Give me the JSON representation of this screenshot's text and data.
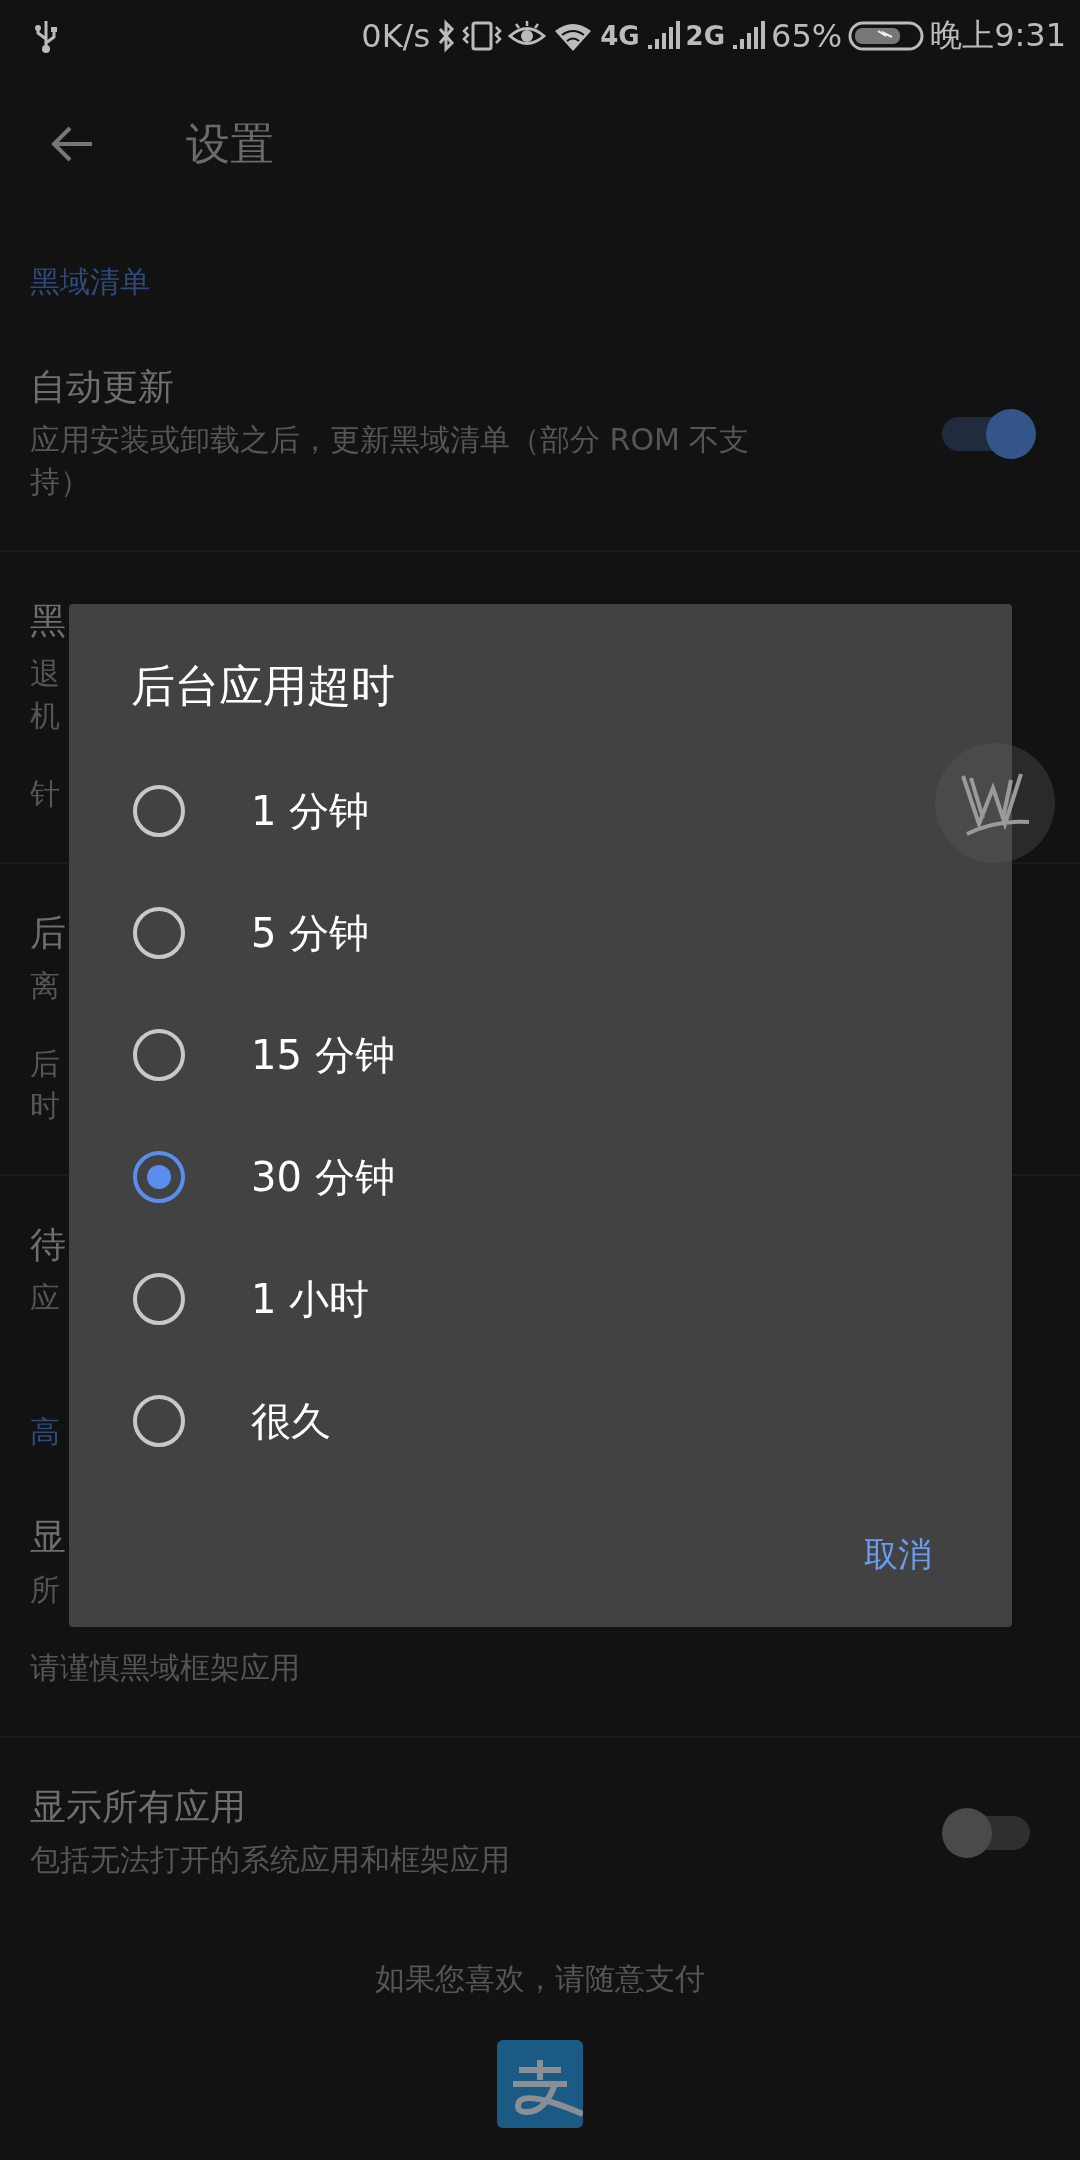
{
  "status_bar": {
    "speed": "0K/s",
    "network_1": "4G",
    "network_2": "2G",
    "battery": "65%",
    "time": "晚上9:31"
  },
  "toolbar": {
    "title": "设置"
  },
  "settings": [
    {
      "kind": "header",
      "text": "黑域清单"
    },
    {
      "kind": "item",
      "title": "自动更新",
      "summary": [
        "应用安装或卸载之后，更新黑域清单（部分 ROM 不支持）"
      ],
      "toggle": {
        "on": true
      }
    },
    {
      "kind": "item",
      "title": "黑",
      "summary": [
        "退",
        "机"
      ],
      "note": [
        "针"
      ]
    },
    {
      "kind": "item",
      "title": "后",
      "summary": [
        "离"
      ],
      "note": [
        "后",
        "时"
      ]
    },
    {
      "kind": "item",
      "title": "待",
      "summary": [
        "应"
      ]
    },
    {
      "kind": "header",
      "text": "高"
    },
    {
      "kind": "item",
      "title": "显",
      "summary": [
        "所"
      ],
      "note": [
        "请谨慎黑域框架应用"
      ]
    },
    {
      "kind": "item",
      "title": "显示所有应用",
      "summary": [
        "包括无法打开的系统应用和框架应用"
      ],
      "toggle": {
        "on": false
      }
    }
  ],
  "footer": {
    "text": "如果您喜欢，请随意支付"
  },
  "dialog": {
    "title": "后台应用超时",
    "options": [
      {
        "label": "1 分钟",
        "selected": false
      },
      {
        "label": "5 分钟",
        "selected": false
      },
      {
        "label": "15 分钟",
        "selected": false
      },
      {
        "label": "30 分钟",
        "selected": true
      },
      {
        "label": "1 小时",
        "selected": false
      },
      {
        "label": "很久",
        "selected": false
      }
    ],
    "buttons": [
      "取消"
    ]
  }
}
